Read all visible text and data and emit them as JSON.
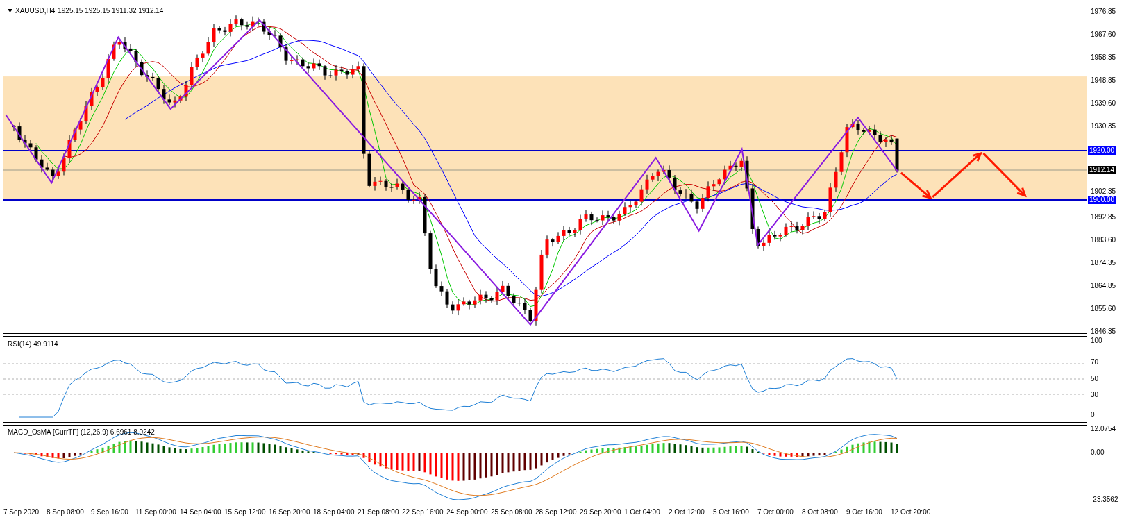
{
  "header": {
    "symbol": "XAUUSD,H4",
    "ohlc": "1925.15 1925.15 1911.32 1912.14"
  },
  "price_axis": {
    "labels": [
      "1976.85",
      "1967.60",
      "1958.35",
      "1948.85",
      "1939.60",
      "1930.35",
      "1902.35",
      "1892.85",
      "1883.60",
      "1874.35",
      "1864.85",
      "1855.60",
      "1846.35"
    ],
    "line_labels": [
      {
        "text": "1920.00",
        "kind": "level"
      },
      {
        "text": "1912.14",
        "kind": "current"
      },
      {
        "text": "1900.00",
        "kind": "level"
      }
    ]
  },
  "rsi": {
    "label": "RSI(14) 49.9114",
    "axis": [
      "100",
      "70",
      "50",
      "30",
      "0"
    ]
  },
  "macd": {
    "label": "MACD_OsMA [CurrTF] (12,26,9) 6.6961 8.0242",
    "axis": [
      "12.0754",
      "0.00",
      "-23.3562"
    ]
  },
  "time_axis": [
    "7 Sep 2020",
    "8 Sep 08:00",
    "9 Sep 16:00",
    "11 Sep 00:00",
    "14 Sep 04:00",
    "15 Sep 12:00",
    "16 Sep 20:00",
    "18 Sep 04:00",
    "21 Sep 08:00",
    "22 Sep 16:00",
    "24 Sep 00:00",
    "25 Sep 08:00",
    "28 Sep 12:00",
    "29 Sep 20:00",
    "1 Oct 04:00",
    "2 Oct 12:00",
    "5 Oct 16:00",
    "7 Oct 00:00",
    "8 Oct 08:00",
    "9 Oct 16:00",
    "12 Oct 20:00"
  ]
}
